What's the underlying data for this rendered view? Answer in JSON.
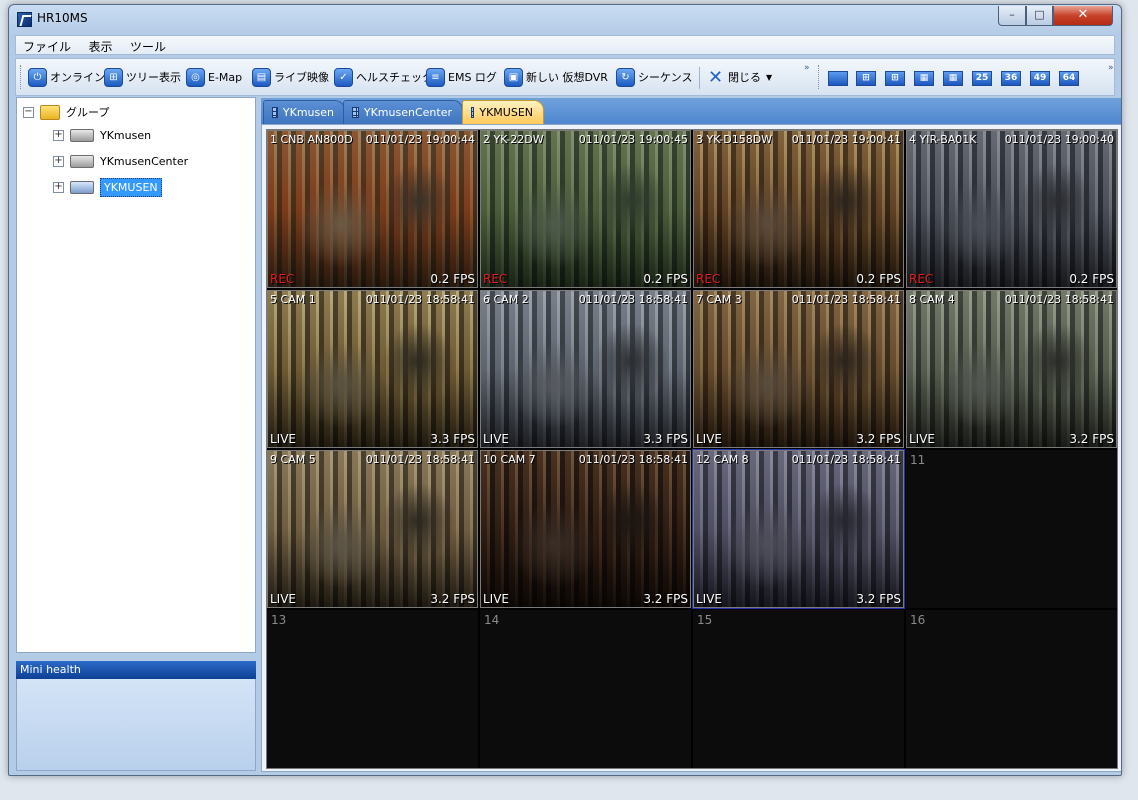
{
  "window": {
    "title": "HR10MS"
  },
  "window_controls": {
    "minimize": "–",
    "maximize": "□",
    "close": "✕"
  },
  "menu": [
    "ファイル",
    "表示",
    "ツール"
  ],
  "toolbar": {
    "items": [
      {
        "label": "オンライン",
        "icon": "power-icon"
      },
      {
        "label": "ツリー表示",
        "icon": "tree-icon"
      },
      {
        "label": "E-Map",
        "icon": "map-icon"
      },
      {
        "label": "ライブ映像",
        "icon": "video-icon"
      },
      {
        "label": "ヘルスチェック",
        "icon": "check-icon"
      },
      {
        "label": "EMS ログ",
        "icon": "log-icon"
      },
      {
        "label": "新しい 仮想DVR",
        "icon": "dvr-icon"
      },
      {
        "label": "シーケンス",
        "icon": "sequence-icon"
      }
    ],
    "close_label": "閉じる",
    "layouts": [
      "1x1",
      "2x2",
      "1+5",
      "3x3",
      "4x4",
      "25",
      "36",
      "49",
      "64"
    ]
  },
  "tree": {
    "root": "グループ",
    "nodes": [
      "YKmusen",
      "YKmusenCenter",
      "YKMUSEN"
    ],
    "selected": "YKMUSEN"
  },
  "mini_health": {
    "title": "Mini health"
  },
  "tabs": [
    {
      "label": "YKmusen",
      "active": false
    },
    {
      "label": "YKmusenCenter",
      "active": false
    },
    {
      "label": "YKMUSEN",
      "active": true
    }
  ],
  "cameras": [
    {
      "num": "1",
      "name": "CNB AN800D",
      "time": "011/01/23 19:00:44",
      "mode": "REC",
      "fps": "0.2 FPS"
    },
    {
      "num": "2",
      "name": "YK-22DW",
      "time": "011/01/23 19:00:45",
      "mode": "REC",
      "fps": "0.2 FPS"
    },
    {
      "num": "3",
      "name": "YK-D158DW",
      "time": "011/01/23 19:00:41",
      "mode": "REC",
      "fps": "0.2 FPS"
    },
    {
      "num": "4",
      "name": "YIR-BA01K",
      "time": "011/01/23 19:00:40",
      "mode": "REC",
      "fps": "0.2 FPS"
    },
    {
      "num": "5",
      "name": "CAM 1",
      "time": "011/01/23 18:58:41",
      "mode": "LIVE",
      "fps": "3.3 FPS"
    },
    {
      "num": "6",
      "name": "CAM 2",
      "time": "011/01/23 18:58:41",
      "mode": "LIVE",
      "fps": "3.3 FPS"
    },
    {
      "num": "7",
      "name": "CAM 3",
      "time": "011/01/23 18:58:41",
      "mode": "LIVE",
      "fps": "3.2 FPS"
    },
    {
      "num": "8",
      "name": "CAM 4",
      "time": "011/01/23 18:58:41",
      "mode": "LIVE",
      "fps": "3.2 FPS"
    },
    {
      "num": "9",
      "name": "CAM 5",
      "time": "011/01/23 18:58:41",
      "mode": "LIVE",
      "fps": "3.2 FPS"
    },
    {
      "num": "10",
      "name": "CAM 7",
      "time": "011/01/23 18:58:41",
      "mode": "LIVE",
      "fps": "3.2 FPS"
    },
    {
      "num": "12",
      "name": "CAM 8",
      "time": "011/01/23 18:58:41",
      "mode": "LIVE",
      "fps": "3.2 FPS"
    }
  ],
  "empty_slots": [
    "11",
    "13",
    "14",
    "15",
    "16"
  ],
  "colors": {
    "rec": "#e21d1d",
    "live": "#ffffff",
    "accent": "#2c6bc7"
  }
}
